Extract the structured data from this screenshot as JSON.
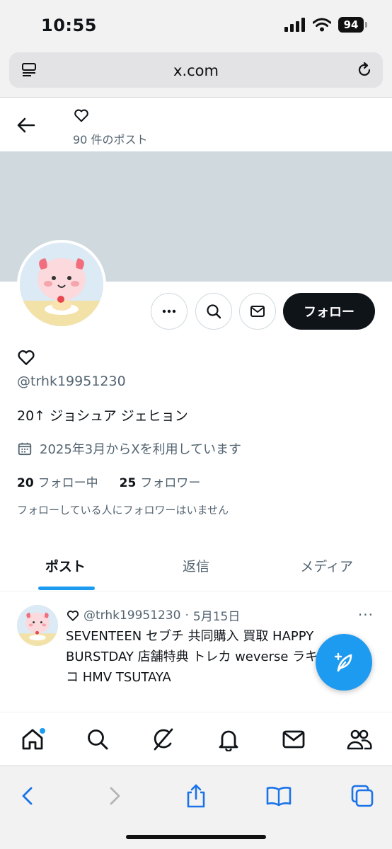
{
  "status_bar": {
    "time": "10:55",
    "battery": "94"
  },
  "browser": {
    "url": "x.com"
  },
  "profile": {
    "post_count": "90 件のポスト",
    "handle": "@trhk19951230",
    "bio": "20↑ ジョシュア ジェヒョン",
    "joined": "2025年3月からXを利用しています",
    "following_count": "20",
    "following_label": "フォロー中",
    "followers_count": "25",
    "followers_label": "フォロワー",
    "mutuals_note": "フォローしている人にフォロワーはいません",
    "follow_button": "フォロー"
  },
  "tabs": [
    {
      "label": "ポスト",
      "active": true
    },
    {
      "label": "返信",
      "active": false
    },
    {
      "label": "メディア",
      "active": false
    }
  ],
  "post": {
    "handle": "@trhk19951230",
    "separator": "·",
    "date": "5月15日",
    "more": "···",
    "text": "SEVENTEEN セブチ 共同購入 買取 HAPPY BURSTDAY 店舗特典 トレカ weverse ラキドロ ワレコ HMV TSUTAYA"
  },
  "icons": {
    "header": [
      "back-arrow-icon",
      "heart-icon"
    ],
    "actions": [
      "more-icon",
      "search-icon",
      "message-icon"
    ],
    "nav": [
      "home-icon",
      "search-icon",
      "grok-icon",
      "bell-icon",
      "mail-icon",
      "communities-icon"
    ],
    "safari": [
      "back-icon",
      "forward-icon",
      "share-icon",
      "bookmarks-icon",
      "tabs-icon"
    ]
  },
  "colors": {
    "accent": "#1d9bf0",
    "banner": "#cfd9de",
    "text": "#0f1419",
    "muted": "#536471"
  }
}
